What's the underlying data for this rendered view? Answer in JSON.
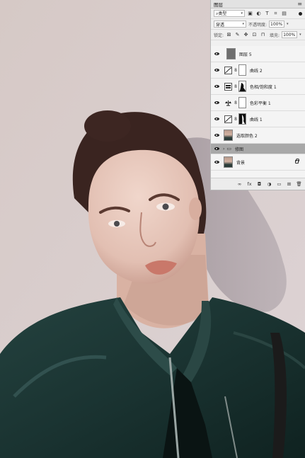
{
  "panel": {
    "tab_title": "图层",
    "menu_glyph": "≡",
    "filter": {
      "label": "类型",
      "arrow": "▾"
    },
    "filter_icons": [
      "image-filter-icon",
      "adjustment-filter-icon",
      "type-filter-icon",
      "shape-filter-icon",
      "smart-object-filter-icon"
    ],
    "blend_mode": "穿透",
    "opacity_label": "不透明度:",
    "opacity_value": "100%",
    "lock_label": "锁定:",
    "fill_label": "填充:",
    "fill_value": "100%"
  },
  "layers": [
    {
      "name": "图层 5",
      "kind": "pixel"
    },
    {
      "name": "曲线 2",
      "kind": "curves"
    },
    {
      "name": "色相/饱和度 1",
      "kind": "hue-saturation"
    },
    {
      "name": "色彩平衡 1",
      "kind": "color-balance"
    },
    {
      "name": "曲线 1",
      "kind": "curves"
    },
    {
      "name": "选取颜色 2",
      "kind": "photo"
    },
    {
      "name": "修图",
      "kind": "group"
    },
    {
      "name": "背景",
      "kind": "background"
    }
  ],
  "footer_icons": [
    "link-icon",
    "fx-icon",
    "add-mask-icon",
    "new-adjustment-icon",
    "new-group-icon",
    "new-layer-icon",
    "delete-icon"
  ],
  "footer": {
    "fx": "fx"
  },
  "colors": {
    "wall": "#d9cfd0",
    "jacket": "#1f3a38",
    "skin": "#e8c8bc",
    "hair": "#3a2420",
    "panel_bg": "#f0f0f0",
    "group_highlight": "#a8a8a8"
  }
}
